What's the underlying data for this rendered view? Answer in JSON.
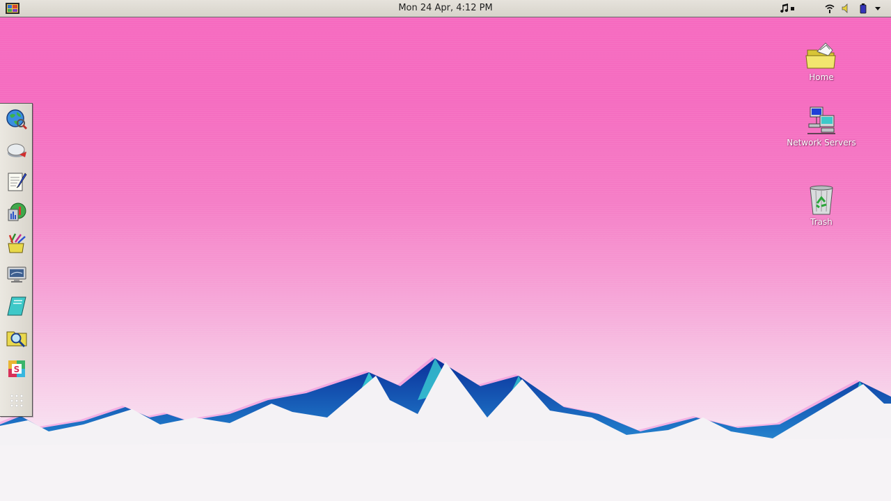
{
  "top_panel": {
    "clock": "Mon 24 Apr,  4:12 PM",
    "menu_icon": "system-menu-icon",
    "tray": [
      "music-player-icon",
      "wifi-icon",
      "volume-icon",
      "battery-icon",
      "dropdown-arrow-icon"
    ]
  },
  "dock": {
    "items": [
      {
        "icon": "web-browser-icon"
      },
      {
        "icon": "mail-client-icon"
      },
      {
        "icon": "text-editor-icon"
      },
      {
        "icon": "system-monitor-icon"
      },
      {
        "icon": "paint-app-icon"
      },
      {
        "icon": "display-settings-icon"
      },
      {
        "icon": "notebook-icon"
      },
      {
        "icon": "file-search-icon"
      },
      {
        "icon": "slack-app-icon"
      },
      {
        "icon": "app-grid-icon"
      }
    ]
  },
  "desktop": {
    "icons": [
      {
        "label": "Home",
        "icon": "home-folder-icon"
      },
      {
        "label": "Network Servers",
        "icon": "network-servers-icon"
      },
      {
        "label": "Trash",
        "icon": "trash-icon"
      }
    ]
  },
  "colors": {
    "sky_top": "#f66ac0",
    "sky_bottom": "#f8dff0",
    "mountain_blue": "#1a6fc4",
    "mountain_cyan": "#2fd0d0",
    "snow": "#f5f3f6",
    "panel": "#dedad2"
  }
}
